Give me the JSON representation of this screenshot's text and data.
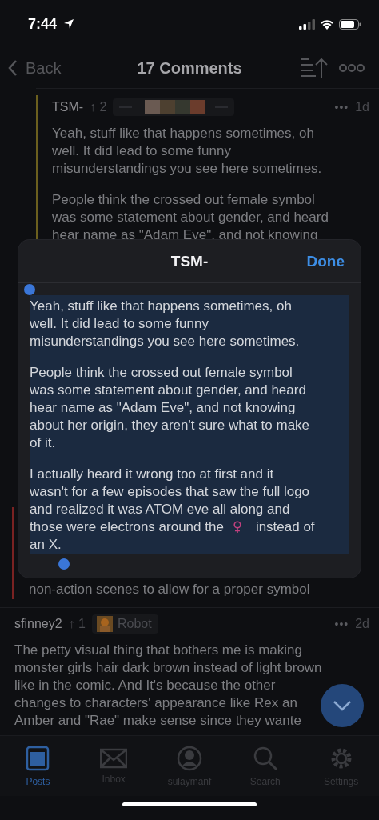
{
  "status_bar": {
    "time": "7:44"
  },
  "nav": {
    "back": "Back",
    "title": "17 Comments"
  },
  "comments": [
    {
      "kind": "thread",
      "author": "TSM-",
      "score": "↑ 2",
      "flair": {
        "kind": "picture"
      },
      "more": "•••",
      "age": "1d",
      "color": "#6b5f1e",
      "paras": [
        [
          "Yeah, stuff like that happens sometimes, oh",
          "well. It did lead to some funny",
          "misunderstandings you see here sometimes."
        ],
        [
          "People think the crossed out female symbol",
          "was some statement about gender, and heard",
          "hear name as \"Adam Eve\", and not knowing"
        ]
      ]
    },
    {
      "kind": "tail",
      "color": "#7a2222",
      "paras": [
        [
          "non-action scenes to allow for a proper symbol"
        ]
      ]
    },
    {
      "kind": "top",
      "author": "sfinney2",
      "score": "↑ 1",
      "flair": {
        "kind": "picture",
        "label": "Robot"
      },
      "more": "•••",
      "age": "2d",
      "paras": [
        [
          "The petty visual thing that bothers me is making",
          "monster girls hair dark brown instead of light brown",
          "like in the comic. And It's because the other",
          "changes to characters' appearance like Rex an",
          "Amber and \"Rae\" make sense since they wante"
        ]
      ]
    }
  ],
  "modal": {
    "title": "TSM-",
    "done": "Done",
    "paras": [
      [
        {
          "text": "Yeah, stuff like that happens sometimes, oh"
        },
        {
          "text": "well. It did lead to some funny"
        },
        {
          "text": "misunderstandings you see here sometimes."
        }
      ],
      [
        {
          "text": "People think the crossed out female symbol"
        },
        {
          "text": "was some statement about gender, and heard"
        },
        {
          "text": "hear name as \"Adam Eve\", and not knowing"
        },
        {
          "text": "about her origin, they aren't sure what to make"
        },
        {
          "text": "of it."
        }
      ],
      [
        {
          "text": "I actually heard it wrong too at first and it"
        },
        {
          "text": "wasn't for a few episodes that saw the full logo"
        },
        {
          "text": "and realized it was ATOM eve all along and"
        },
        {
          "kind": "symbol",
          "before": "those were electrons around the",
          "after": "instead of"
        },
        {
          "text": "an X."
        }
      ]
    ]
  },
  "tabs": [
    {
      "kind": "posts",
      "label": "Posts",
      "selected": true
    },
    {
      "kind": "inbox",
      "label": "Inbox",
      "selected": false
    },
    {
      "kind": "user",
      "label": "sulaymanf",
      "selected": false
    },
    {
      "kind": "search",
      "label": "Search",
      "selected": false
    },
    {
      "kind": "settings",
      "label": "Settings",
      "selected": false
    }
  ]
}
